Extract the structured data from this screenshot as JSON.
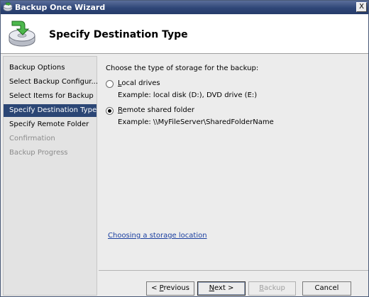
{
  "window": {
    "title": "Backup Once Wizard",
    "close_glyph": "X"
  },
  "header": {
    "title": "Specify Destination Type",
    "icon": "backup-drive-icon"
  },
  "sidebar": {
    "steps": [
      {
        "label": "Backup Options",
        "state": "normal"
      },
      {
        "label": "Select Backup Configur...",
        "state": "normal"
      },
      {
        "label": "Select Items for Backup",
        "state": "normal"
      },
      {
        "label": "Specify Destination Type",
        "state": "active"
      },
      {
        "label": "Specify Remote Folder",
        "state": "normal"
      },
      {
        "label": "Confirmation",
        "state": "disabled"
      },
      {
        "label": "Backup Progress",
        "state": "disabled"
      }
    ]
  },
  "content": {
    "prompt": "Choose the type of storage for the backup:",
    "options": [
      {
        "accel": "L",
        "label_rest": "ocal drives",
        "example": "Example: local disk (D:), DVD drive (E:)",
        "selected": false
      },
      {
        "accel": "R",
        "label_rest": "emote shared folder",
        "example": "Example: \\\\MyFileServer\\SharedFolderName",
        "selected": true
      }
    ],
    "help_link": "Choosing a storage location"
  },
  "buttons": {
    "previous": {
      "pre": "< ",
      "accel": "P",
      "post": "revious"
    },
    "next": {
      "pre": "",
      "accel": "N",
      "post": "ext >"
    },
    "backup": {
      "pre": "",
      "accel": "B",
      "post": "ackup"
    },
    "cancel": {
      "label": "Cancel"
    }
  },
  "colors": {
    "title_bar": "#2f4677",
    "active_step": "#2b4675",
    "link": "#1a3fa0"
  }
}
